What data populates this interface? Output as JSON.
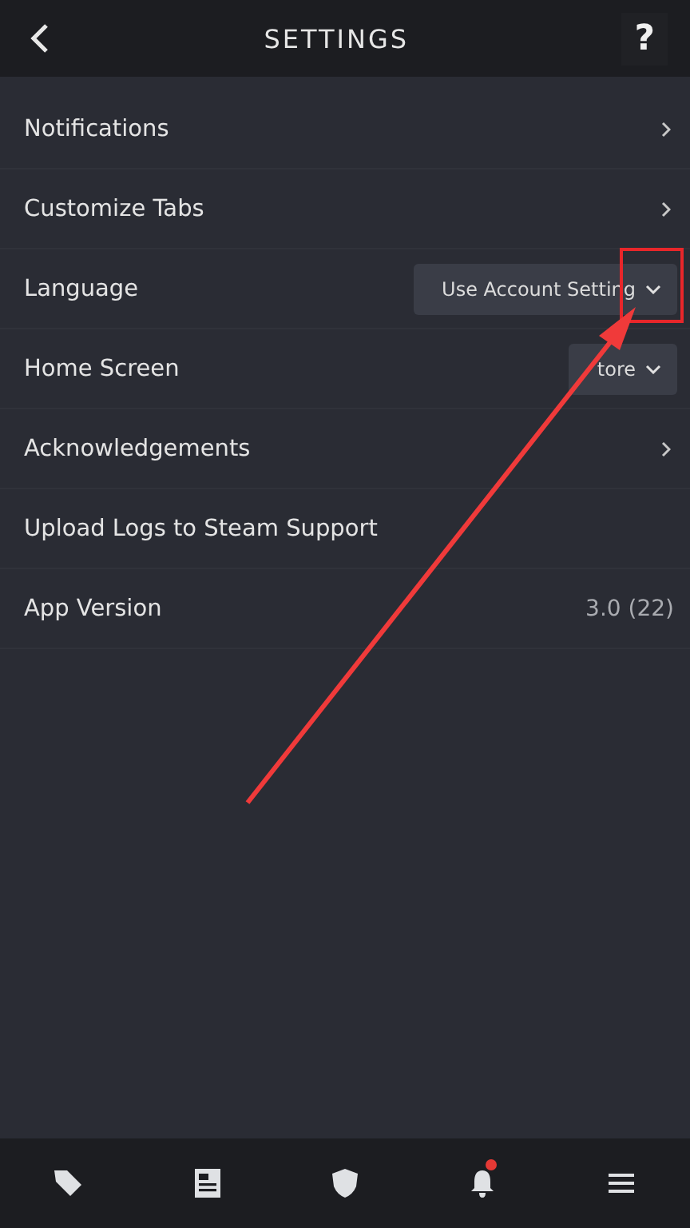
{
  "header": {
    "title": "SETTINGS",
    "help": "?"
  },
  "rows": [
    {
      "kind": "link",
      "label": "Notifications"
    },
    {
      "kind": "link",
      "label": "Customize Tabs"
    },
    {
      "kind": "dropdown",
      "label": "Language",
      "value": "Use Account Setting"
    },
    {
      "kind": "dropdown",
      "label": "Home Screen",
      "value": "tore"
    },
    {
      "kind": "link",
      "label": "Acknowledgements"
    },
    {
      "kind": "action",
      "label": "Upload Logs to Steam Support"
    },
    {
      "kind": "value",
      "label": "App Version",
      "value": "3.0 (22)"
    }
  ],
  "bottom_nav": [
    {
      "kind": "tag",
      "badge": false
    },
    {
      "kind": "news",
      "badge": false
    },
    {
      "kind": "shield",
      "badge": false
    },
    {
      "kind": "bell",
      "badge": true
    },
    {
      "kind": "menu",
      "badge": false
    }
  ]
}
